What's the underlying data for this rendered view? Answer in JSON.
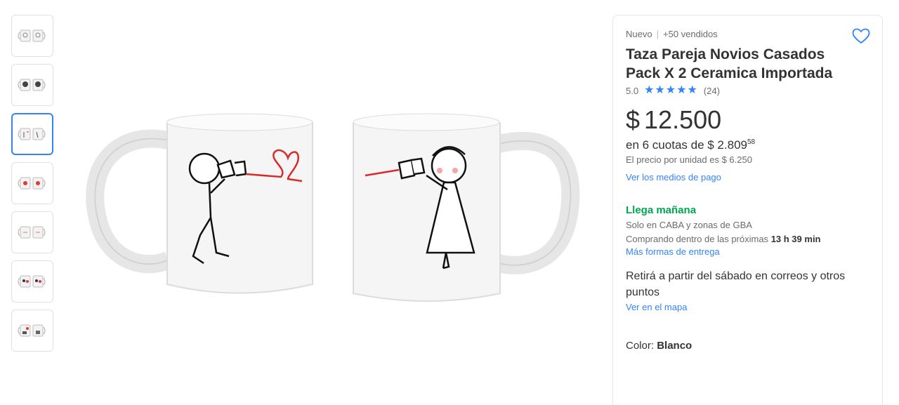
{
  "thumbnails": [
    {
      "label": "thumbnail-1",
      "active": false
    },
    {
      "label": "thumbnail-2",
      "active": false
    },
    {
      "label": "thumbnail-3",
      "active": true
    },
    {
      "label": "thumbnail-4",
      "active": false
    },
    {
      "label": "thumbnail-5",
      "active": false
    },
    {
      "label": "thumbnail-6",
      "active": false
    },
    {
      "label": "thumbnail-7",
      "active": false
    }
  ],
  "product": {
    "condition": "Nuevo",
    "sold": "+50 vendidos",
    "title": "Taza Pareja Novios Casados Pack X 2 Ceramica Importada",
    "rating_value": "5.0",
    "rating_count": "(24)",
    "stars": 5,
    "currency": "$",
    "price": "12.500",
    "installments_text": "en 6 cuotas de $ 2.809",
    "installments_cents": "58",
    "unit_price": "El precio por unidad es $ 6.250",
    "payment_link": "Ver los medios de pago"
  },
  "shipping": {
    "title": "Llega mañana",
    "zone": "Solo en CABA y zonas de GBA",
    "buy_within_prefix": "Comprando dentro de las próximas",
    "buy_within_time": "13 h 39 min",
    "more_link": "Más formas de entrega"
  },
  "pickup": {
    "text": "Retirá a partir del sábado en correos y otros puntos",
    "map_link": "Ver en el mapa"
  },
  "variant": {
    "label": "Color:",
    "value": "Blanco"
  },
  "colors": {
    "accent": "#3483fa",
    "green": "#00a650"
  },
  "icons": {
    "favorite": "heart-outline-icon",
    "star": "star-icon"
  }
}
